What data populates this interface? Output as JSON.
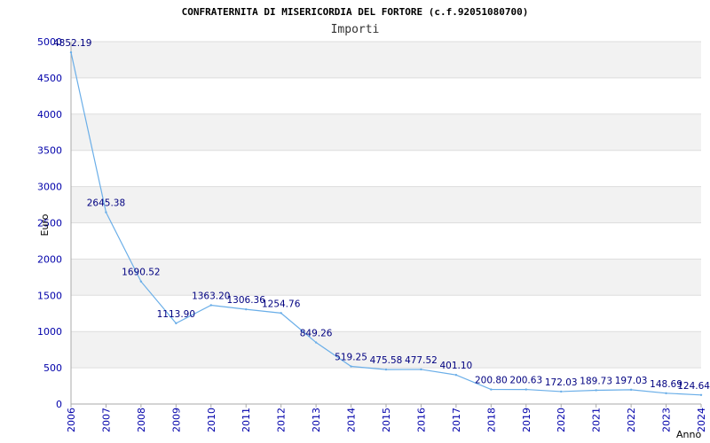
{
  "chart_data": {
    "type": "line",
    "title": "CONFRATERNITA DI MISERICORDIA DEL FORTORE (c.f.92051080700)",
    "subtitle": "Importi",
    "ylabel": "Euro",
    "xlabel": "Anno",
    "ylim": [
      0,
      5000
    ],
    "yticks": [
      "0",
      "500",
      "1000",
      "1500",
      "2000",
      "2500",
      "3000",
      "3500",
      "4000",
      "4500",
      "5000"
    ],
    "grid": "horizontal bands",
    "line_color": "#6aaee8",
    "categories": [
      "2006",
      "2007",
      "2008",
      "2009",
      "2010",
      "2011",
      "2012",
      "2013",
      "2014",
      "2015",
      "2016",
      "2017",
      "2018",
      "2019",
      "2020",
      "2021",
      "2022",
      "2023",
      "2024"
    ],
    "values": [
      4852.19,
      2645.38,
      1690.52,
      1113.9,
      1363.2,
      1306.36,
      1254.76,
      849.26,
      519.25,
      475.58,
      477.52,
      401.1,
      200.8,
      200.63,
      172.03,
      189.73,
      197.03,
      148.69,
      124.64
    ],
    "labels": [
      "4852.19",
      "2645.38",
      "1690.52",
      "1113.90",
      "1363.20",
      "1306.36",
      "1254.76",
      "849.26",
      "519.25",
      "475.58",
      "477.52",
      "401.10",
      "200.80",
      "200.63",
      "172.03",
      "189.73",
      "197.03",
      "148.69",
      "124.64"
    ]
  }
}
